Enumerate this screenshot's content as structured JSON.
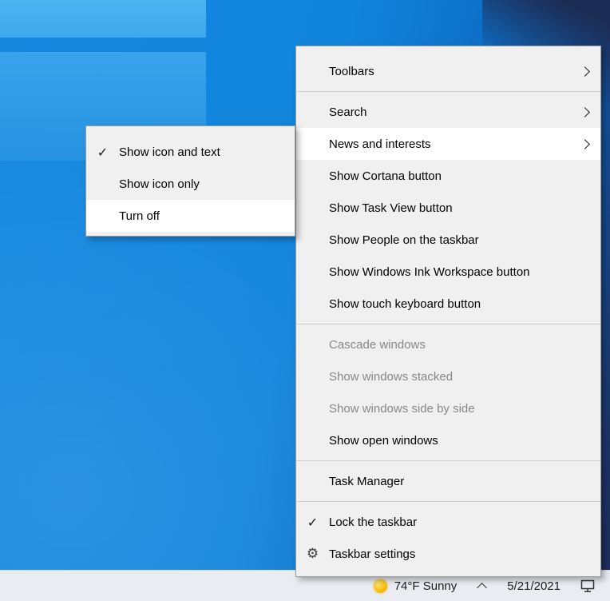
{
  "menu": {
    "items": [
      {
        "label": "Toolbars"
      },
      {
        "label": "Search"
      },
      {
        "label": "News and interests"
      },
      {
        "label": "Show Cortana button"
      },
      {
        "label": "Show Task View button"
      },
      {
        "label": "Show People on the taskbar"
      },
      {
        "label": "Show Windows Ink Workspace button"
      },
      {
        "label": "Show touch keyboard button"
      },
      {
        "label": "Cascade windows"
      },
      {
        "label": "Show windows stacked"
      },
      {
        "label": "Show windows side by side"
      },
      {
        "label": "Show open windows"
      },
      {
        "label": "Task Manager"
      },
      {
        "label": "Lock the taskbar"
      },
      {
        "label": "Taskbar settings"
      }
    ]
  },
  "submenu": {
    "items": [
      {
        "label": "Show icon and text"
      },
      {
        "label": "Show icon only"
      },
      {
        "label": "Turn off"
      }
    ]
  },
  "taskbar": {
    "weather": "74°F Sunny",
    "date": "5/21/2021"
  },
  "icons": {
    "check": "✓",
    "gear": "⚙"
  },
  "colors": {
    "menu_bg": "#f0f0f0",
    "highlight": "#ffffff",
    "disabled_text": "#878787",
    "desktop_blue": "#1184dc",
    "taskbar_bg": "#e9edf2",
    "sun_yellow": "#f7b500"
  }
}
